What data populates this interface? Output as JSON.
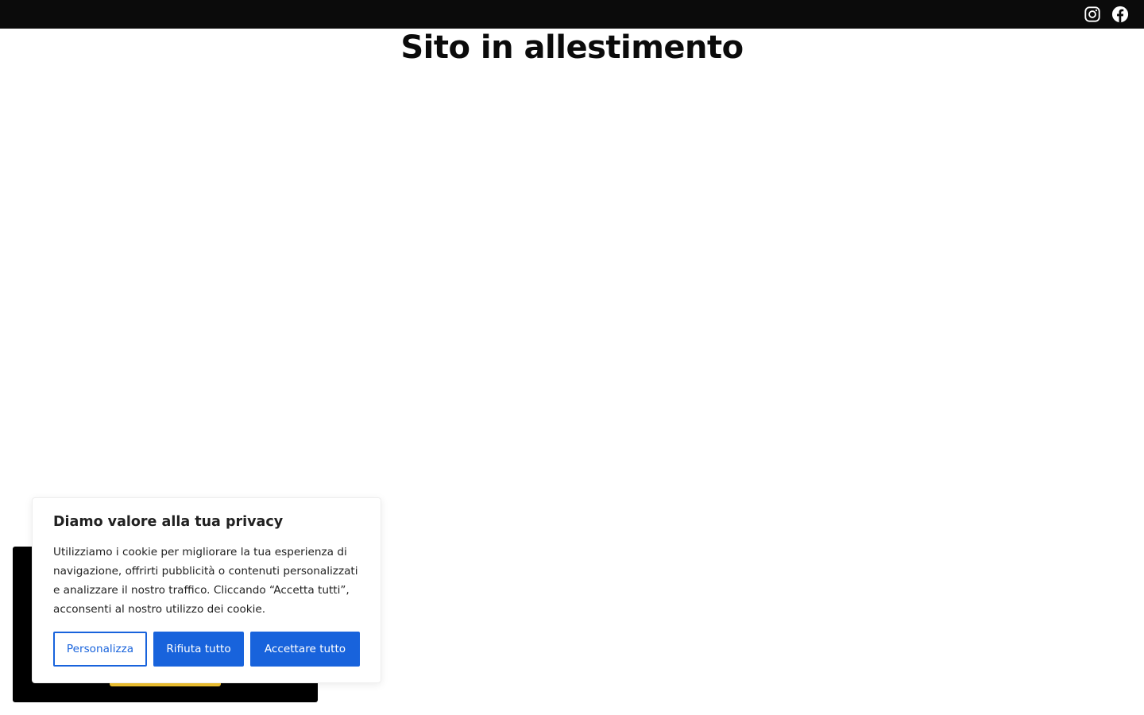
{
  "header": {
    "social": [
      {
        "icon": "instagram-icon",
        "label": "Instagram"
      },
      {
        "icon": "facebook-icon",
        "label": "Facebook"
      }
    ],
    "colors": {
      "background": "#0b0b0b",
      "icon": "#ffffff"
    }
  },
  "main": {
    "title": "Sito in allestimento"
  },
  "cookie_banner": {
    "title": "Diamo valore alla tua privacy",
    "text": "Utilizziamo i cookie per migliorare la tua esperienza di navigazione, offrirti pubblicità o contenuti personalizzati e analizzare il nostro traffico. Cliccando “Accetta tutti”, acconsenti al nostro utilizzo dei cookie.",
    "buttons": {
      "customize": "Personalizza",
      "reject": "Rifiuta tutto",
      "accept": "Accettare tutto"
    },
    "colors": {
      "primary": "#1863dc",
      "text": "#212121"
    }
  },
  "hidden_notice": {
    "colors": {
      "background": "#000000",
      "button": "#f0c330"
    }
  }
}
